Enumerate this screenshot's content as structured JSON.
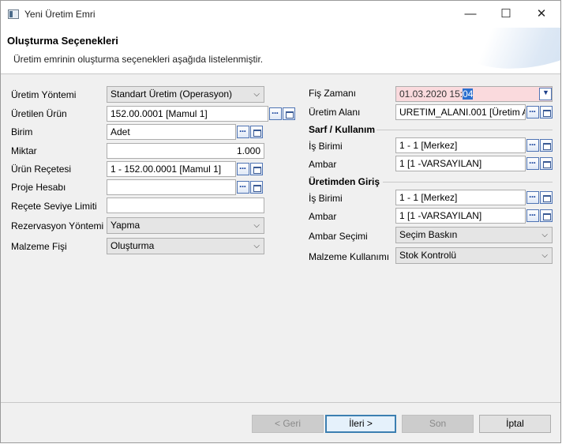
{
  "window": {
    "title": "Yeni Üretim Emri",
    "minimize": "—",
    "maximize": "☐",
    "close": "✕"
  },
  "header": {
    "title": "Oluşturma Seçenekleri",
    "subtitle": "Üretim emrinin oluşturma seçenekleri aşağıda listelenmiştir."
  },
  "left": {
    "uretim_yontemi": {
      "label": "Üretim Yöntemi",
      "value": "Standart Üretim (Operasyon)"
    },
    "uretilen_urun": {
      "label": "Üretilen Ürün",
      "value": "152.00.0001 [Mamul 1]"
    },
    "birim": {
      "label": "Birim",
      "value": "Adet"
    },
    "miktar": {
      "label": "Miktar",
      "value": "1.000"
    },
    "urun_recetesi": {
      "label": "Ürün Reçetesi",
      "value": "1 - 152.00.0001 [Mamul 1]"
    },
    "proje_hesabi": {
      "label": "Proje Hesabı",
      "value": ""
    },
    "recete_seviye": {
      "label": "Reçete Seviye Limiti",
      "value": ""
    },
    "rezervasyon": {
      "label": "Rezervasyon Yöntemi",
      "value": "Yapma"
    },
    "malzeme_fisi": {
      "label": "Malzeme Fişi",
      "value": "Oluşturma"
    }
  },
  "right": {
    "fis_zamani": {
      "label": "Fiş Zamanı",
      "value_main": "01.03.2020 15:",
      "value_sel": "04"
    },
    "uretim_alani": {
      "label": "Üretim Alanı",
      "value": "URETIM_ALANI.001 [Üretim Al"
    },
    "sarf": {
      "heading": "Sarf / Kullanım",
      "is_birimi": {
        "label": "İş Birimi",
        "value": "1 - 1 [Merkez]"
      },
      "ambar": {
        "label": "Ambar",
        "value": "1 [1 -VARSAYILAN]"
      }
    },
    "giris": {
      "heading": "Üretimden Giriş",
      "is_birimi": {
        "label": "İş Birimi",
        "value": "1 - 1 [Merkez]"
      },
      "ambar": {
        "label": "Ambar",
        "value": "1 [1 -VARSAYILAN]"
      },
      "ambar_secimi": {
        "label": "Ambar Seçimi",
        "value": "Seçim Baskın"
      },
      "malzeme_kullanimi": {
        "label": "Malzeme Kullanımı",
        "value": "Stok Kontrolü"
      }
    }
  },
  "footer": {
    "back": "< Geri",
    "next": "İleri >",
    "finish": "Son",
    "cancel": "İptal"
  },
  "colors": {
    "date_highlight": "#fadadd",
    "selection": "#2b6fcf"
  }
}
